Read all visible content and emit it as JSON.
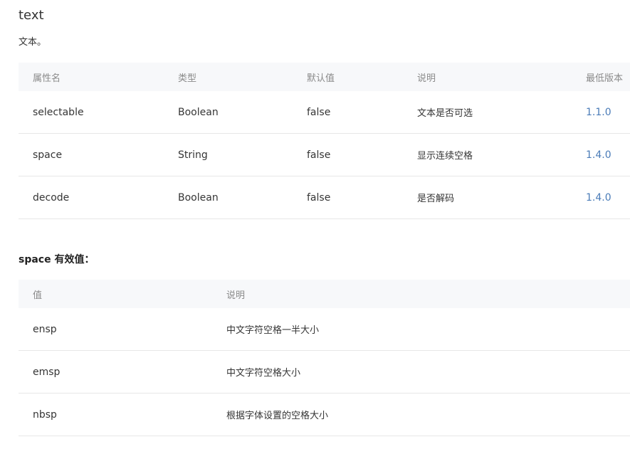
{
  "title": "text",
  "description": "文本。",
  "attrs_table": {
    "headers": [
      "属性名",
      "类型",
      "默认值",
      "说明",
      "最低版本"
    ],
    "rows": [
      [
        "selectable",
        "Boolean",
        "false",
        "文本是否可选",
        "1.1.0"
      ],
      [
        "space",
        "String",
        "false",
        "显示连续空格",
        "1.4.0"
      ],
      [
        "decode",
        "Boolean",
        "false",
        "是否解码",
        "1.4.0"
      ]
    ]
  },
  "space_heading": "space 有效值：",
  "space_table": {
    "headers": [
      "值",
      "说明"
    ],
    "rows": [
      [
        "ensp",
        "中文字符空格一半大小"
      ],
      [
        "emsp",
        "中文字符空格大小"
      ],
      [
        "nbsp",
        "根据字体设置的空格大小"
      ]
    ]
  },
  "colors": {
    "link": "#4b7cb8",
    "header_bg": "#f7f8fa",
    "border": "#e7e7e7"
  }
}
